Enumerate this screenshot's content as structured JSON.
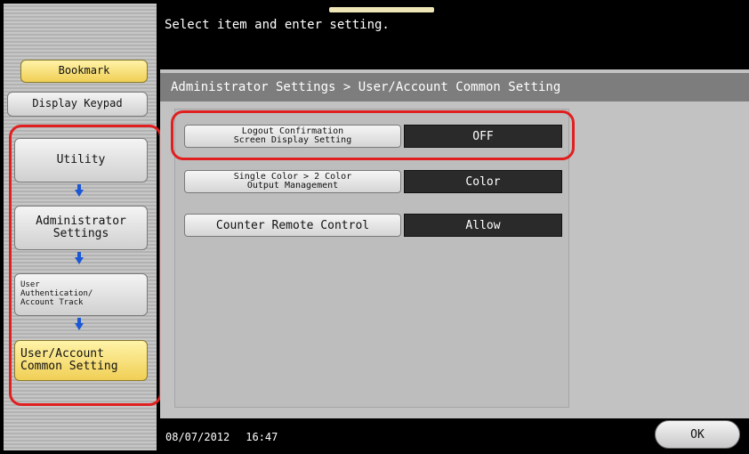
{
  "sidebar": {
    "bookmark": "Bookmark",
    "display_keypad": "Display Keypad",
    "utility": "Utility",
    "administrator_settings": "Administrator\nSettings",
    "user_auth": "User\nAuthentication/\nAccount Track",
    "user_account_common": "User/Account\nCommon Setting"
  },
  "header": {
    "message": "Select item and enter setting.",
    "breadcrumb": "Administrator Settings > User/Account Common Setting"
  },
  "settings": [
    {
      "label": "Logout Confirmation\nScreen Display Setting",
      "value": "OFF"
    },
    {
      "label": "Single Color > 2 Color\nOutput Management",
      "value": "Color"
    },
    {
      "label": "Counter Remote Control",
      "value": "Allow"
    }
  ],
  "status": {
    "date": "08/07/2012",
    "time": "16:47"
  },
  "footer": {
    "ok_label": "OK"
  },
  "colors": {
    "highlight_outline": "#e02020",
    "yellow_button": "#f0cf55",
    "arrow": "#1c58d6"
  }
}
